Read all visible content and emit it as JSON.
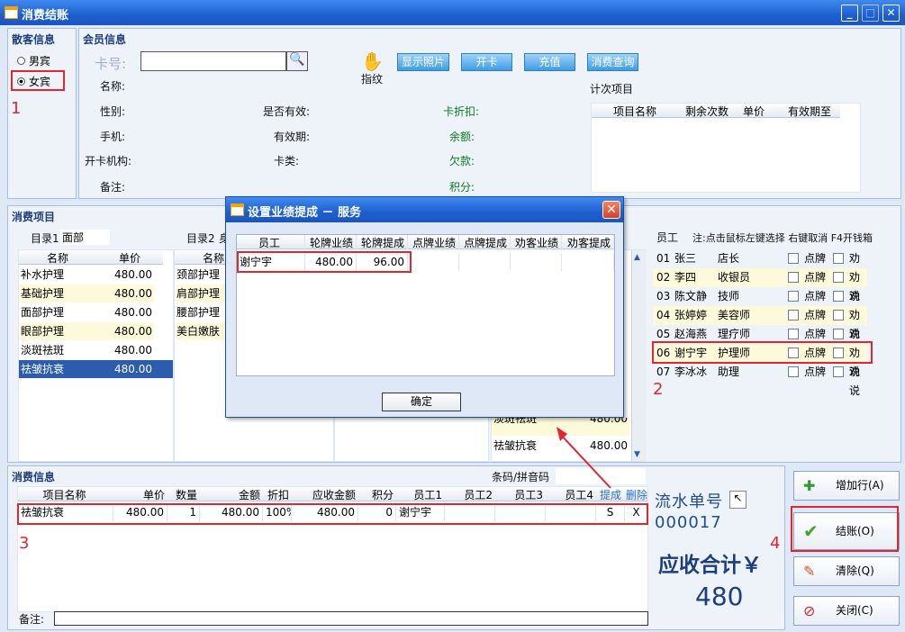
{
  "window": {
    "title": "消费结账"
  },
  "customer": {
    "title": "散客信息",
    "male_label": "男宾",
    "female_label": "女宾",
    "marker": "1"
  },
  "member": {
    "title": "会员信息",
    "card_label": "卡号:",
    "card_value": "",
    "fingerprint_label": "指纹",
    "buttons": [
      "显示照片",
      "开卡",
      "充值",
      "消费查询"
    ],
    "fields_left": [
      "名称:",
      "性别:",
      "手机:",
      "开卡机构:",
      "备注:"
    ],
    "fields_mid": [
      "是否有效:",
      "有效期:",
      "卡类:"
    ],
    "fields_right": [
      "卡折扣:",
      "余额:",
      "欠款:",
      "积分:"
    ],
    "count_items_title": "计次项目",
    "count_items_headers": [
      "项目名称",
      "剩余次数",
      "单价",
      "有效期至"
    ]
  },
  "consume_items": {
    "title": "消费项目",
    "cat1_label": "目录1",
    "cat1_value": "面部",
    "cat2_label": "目录2",
    "cat2_value": "身",
    "headers": [
      "名称",
      "单价"
    ],
    "list1": [
      {
        "name": "补水护理",
        "price": "480.00"
      },
      {
        "name": "基础护理",
        "price": "480.00"
      },
      {
        "name": "面部护理",
        "price": "480.00"
      },
      {
        "name": "眼部护理",
        "price": "480.00"
      },
      {
        "name": "淡斑祛斑",
        "price": "480.00"
      },
      {
        "name": "祛皱抗衰",
        "price": "480.00"
      }
    ],
    "list2_header": "名称",
    "list2": [
      "颈部护理",
      "肩部护理",
      "腰部护理",
      "美白嫩肤"
    ],
    "list4_partial": [
      {
        "name": "淡斑祛斑",
        "price": "480.00"
      },
      {
        "name": "祛皱抗衰",
        "price": "480.00"
      }
    ]
  },
  "staff": {
    "title": "员工",
    "note": "注:点击鼠标左键选择 右键取消 F4开钱箱",
    "marker": "2",
    "check1_label": "点牌",
    "check2_label": "劝说",
    "rows": [
      {
        "no": "01",
        "name": "张三",
        "role": "店长"
      },
      {
        "no": "02",
        "name": "李四",
        "role": "收银员"
      },
      {
        "no": "03",
        "name": "陈文静",
        "role": "技师"
      },
      {
        "no": "04",
        "name": "张婷婷",
        "role": "美容师"
      },
      {
        "no": "05",
        "name": "赵海燕",
        "role": "理疗师"
      },
      {
        "no": "06",
        "name": "谢宁宇",
        "role": "护理师"
      },
      {
        "no": "07",
        "name": "李冰冰",
        "role": "助理"
      }
    ]
  },
  "dialog": {
    "title": "设置业绩提成 － 服务",
    "headers": [
      "员工",
      "轮牌业绩",
      "轮牌提成",
      "点牌业绩",
      "点牌提成",
      "劝客业绩",
      "劝客提成"
    ],
    "row": [
      "谢宁宇",
      "480.00",
      "96.00",
      "",
      "",
      "",
      ""
    ],
    "ok_label": "确定"
  },
  "consume_info": {
    "title": "消费信息",
    "barcode_label": "条码/拼音码",
    "barcode_value": "",
    "headers": [
      "项目名称",
      "单价",
      "数量",
      "金额",
      "折扣",
      "应收金额",
      "积分",
      "员工1",
      "员工2",
      "员工3",
      "员工4",
      "提成",
      "删除"
    ],
    "row": [
      "祛皱抗衰",
      "480.00",
      "1",
      "480.00",
      "100%",
      "480.00",
      "0",
      "谢宁宇",
      "",
      "",
      "",
      "S",
      "X"
    ],
    "marker": "3",
    "remark_label": "备注:",
    "remark_value": ""
  },
  "summary": {
    "serial_label": "流水单号",
    "serial_value": "000017",
    "total_label": "应收合计￥",
    "total_value": "480",
    "marker": "4"
  },
  "actions": {
    "add_row": "增加行(A)",
    "checkout": "结账(O)",
    "clear": "清除(Q)",
    "close": "关闭(C)"
  }
}
